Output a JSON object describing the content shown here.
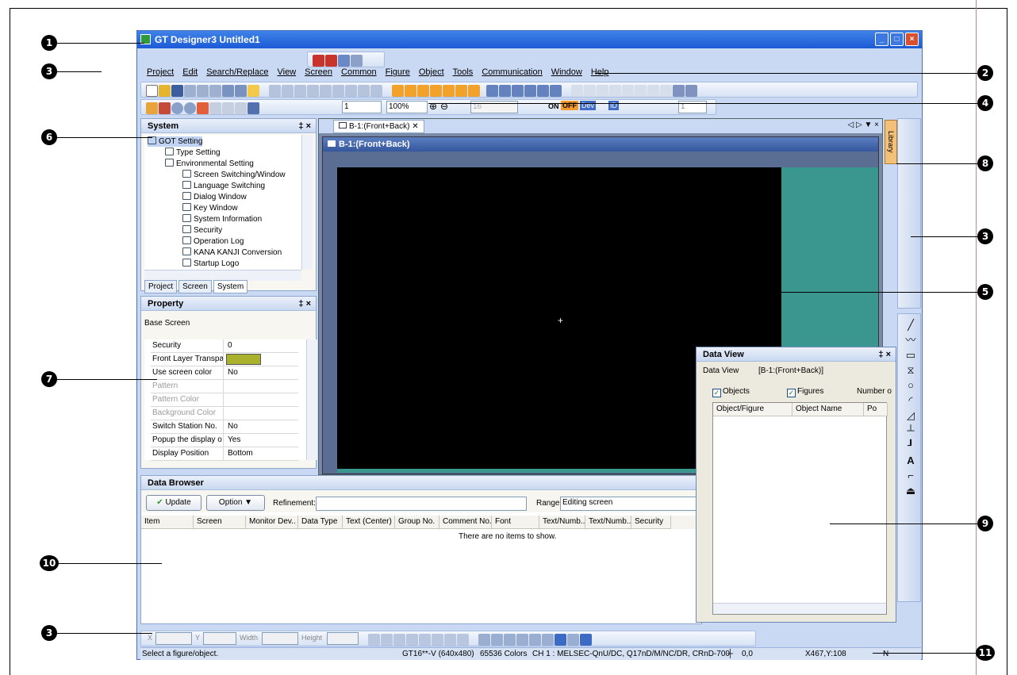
{
  "window": {
    "title": "GT Designer3 Untitled1",
    "buttons": [
      "_",
      "□",
      "×"
    ]
  },
  "menu": [
    "Project",
    "Edit",
    "Search/Replace",
    "View",
    "Screen",
    "Common",
    "Figure",
    "Object",
    "Tools",
    "Communication",
    "Window",
    "Help"
  ],
  "toolbar": {
    "screen_no": "1",
    "zoom": "100%",
    "disabled_value": "16",
    "value_1": "1",
    "on_label": "ON",
    "off_label": "OFF",
    "dev_label": "Dev",
    "id_label": "ID"
  },
  "system_panel": {
    "title": "System",
    "controls": "‡ ×",
    "tree": [
      {
        "label": "GOT Setting",
        "level": 0,
        "selected": true
      },
      {
        "label": "Type Setting",
        "level": 1
      },
      {
        "label": "Environmental Setting",
        "level": 1
      },
      {
        "label": "Screen Switching/Window",
        "level": 2
      },
      {
        "label": "Language Switching",
        "level": 2
      },
      {
        "label": "Dialog Window",
        "level": 2
      },
      {
        "label": "Key Window",
        "level": 2
      },
      {
        "label": "System Information",
        "level": 2
      },
      {
        "label": "Security",
        "level": 2
      },
      {
        "label": "Operation Log",
        "level": 2
      },
      {
        "label": "KANA KANJI Conversion",
        "level": 2
      },
      {
        "label": "Startup Logo",
        "level": 2
      }
    ],
    "tabs": [
      "Project",
      "Screen",
      "System"
    ]
  },
  "property_panel": {
    "title": "Property",
    "controls": "‡ ×",
    "subtitle": "Base Screen",
    "rows": [
      {
        "key": "Security",
        "value": "0"
      },
      {
        "key": "Front Layer Transpa",
        "value": ""
      },
      {
        "key": "Use screen color",
        "value": "No"
      },
      {
        "key": "Pattern",
        "value": "",
        "disabled": true
      },
      {
        "key": "Pattern Color",
        "value": "",
        "disabled": true
      },
      {
        "key": "Background Color",
        "value": "",
        "disabled": true
      },
      {
        "key": "Switch Station No.",
        "value": "No"
      },
      {
        "key": "Popup the display o",
        "value": "Yes"
      },
      {
        "key": "Display Position",
        "value": "Bottom"
      }
    ],
    "swatch_color": "#aab12c"
  },
  "editor": {
    "tab_label": "B-1:(Front+Back)",
    "screen_title": "B-1:(Front+Back)",
    "tab_nav": "◁ ▷ ▼ ×",
    "library_label": "Library"
  },
  "data_view": {
    "title": "Data View",
    "controls": "‡ ×",
    "label": "Data View",
    "screen": "[B-1:(Front+Back)]",
    "objects_label": "Objects",
    "figures_label": "Figures",
    "number_label": "Number o",
    "columns": [
      "Object/Figure",
      "Object Name",
      "Po"
    ]
  },
  "data_browser": {
    "title": "Data Browser",
    "update_label": "Update",
    "option_label": "Option",
    "refinement_label": "Refinement:",
    "range_label": "Range:",
    "range_value": "Editing screen",
    "columns": [
      "Item",
      "Screen",
      "Monitor Dev..",
      "Data Type",
      "Text (Center)",
      "Group No.",
      "Comment No.",
      "Font",
      "Text/Numb..",
      "Text/Numb..",
      "Security"
    ],
    "empty_message": "There are no items to show."
  },
  "bottom_toolbar": {
    "x_label": "X",
    "y_label": "Y",
    "width_label": "Width",
    "height_label": "Height"
  },
  "status": {
    "message": "Select a figure/object.",
    "got_type": "GT16**-V (640x480)",
    "colors": "65536 Colors",
    "channel": "CH 1 : MELSEC-QnU/DC, Q17nD/M/NC/DR, CRnD-700",
    "origin": "0,0",
    "cursor": "X467,Y:108",
    "mode": "N"
  },
  "callouts": [
    "1",
    "2",
    "3",
    "4",
    "5",
    "6",
    "7",
    "8",
    "3",
    "9",
    "10",
    "3",
    "11"
  ]
}
